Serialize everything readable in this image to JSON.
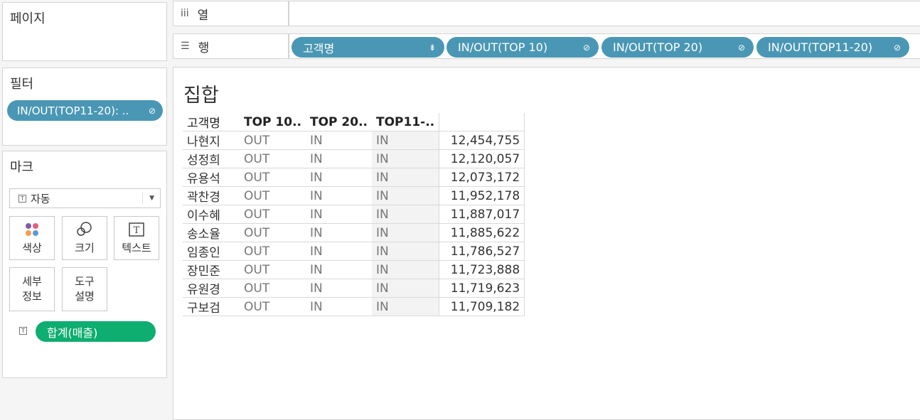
{
  "pages": {
    "title": "페이지"
  },
  "filters": {
    "title": "필터",
    "pill": "IN/OUT(TOP11-20): .."
  },
  "marks": {
    "title": "마크",
    "type_select": "자동",
    "buttons": [
      {
        "label": "색상",
        "icon": "color-icon"
      },
      {
        "label": "크기",
        "icon": "size-icon"
      },
      {
        "label": "텍스트",
        "icon": "text-icon"
      },
      {
        "label_line1": "세부",
        "label_line2": "정보"
      },
      {
        "label_line1": "도구",
        "label_line2": "설명"
      }
    ],
    "text_pill": "합계(매출)"
  },
  "shelves": {
    "columns": {
      "label": "열",
      "icon": "columns-icon"
    },
    "rows": {
      "label": "행",
      "icon": "rows-icon",
      "pills": [
        "고객명",
        "IN/OUT(TOP 10)",
        "IN/OUT(TOP 20)",
        "IN/OUT(TOP11-20)"
      ]
    }
  },
  "viz": {
    "title": "집합",
    "headers": [
      "고객명",
      "TOP 10..",
      "TOP 20..",
      "TOP11-..",
      ""
    ],
    "rows": [
      [
        "나현지",
        "OUT",
        "IN",
        "IN",
        "12,454,755"
      ],
      [
        "성정희",
        "OUT",
        "IN",
        "IN",
        "12,120,057"
      ],
      [
        "유용석",
        "OUT",
        "IN",
        "IN",
        "12,073,172"
      ],
      [
        "곽찬경",
        "OUT",
        "IN",
        "IN",
        "11,952,178"
      ],
      [
        "이수혜",
        "OUT",
        "IN",
        "IN",
        "11,887,017"
      ],
      [
        "송소율",
        "OUT",
        "IN",
        "IN",
        "11,885,622"
      ],
      [
        "임종인",
        "OUT",
        "IN",
        "IN",
        "11,786,527"
      ],
      [
        "장민준",
        "OUT",
        "IN",
        "IN",
        "11,723,888"
      ],
      [
        "유원경",
        "OUT",
        "IN",
        "IN",
        "11,719,623"
      ],
      [
        "구보검",
        "OUT",
        "IN",
        "IN",
        "11,709,182"
      ]
    ]
  },
  "colors": {
    "dimension_pill": "#4a97b5",
    "measure_pill": "#0ead70"
  }
}
